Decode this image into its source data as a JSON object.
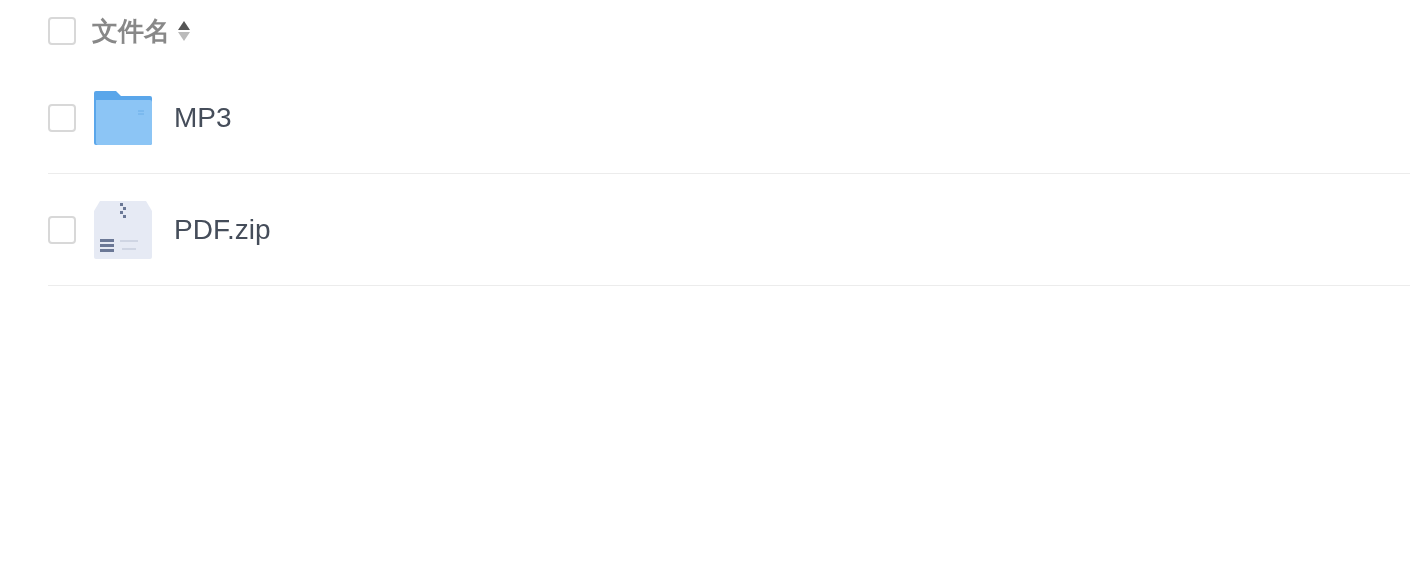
{
  "header": {
    "checked": false,
    "label": "文件名"
  },
  "files": [
    {
      "kind": "folder",
      "name": "MP3",
      "checked": false
    },
    {
      "kind": "zip",
      "name": "PDF.zip",
      "checked": false
    }
  ]
}
